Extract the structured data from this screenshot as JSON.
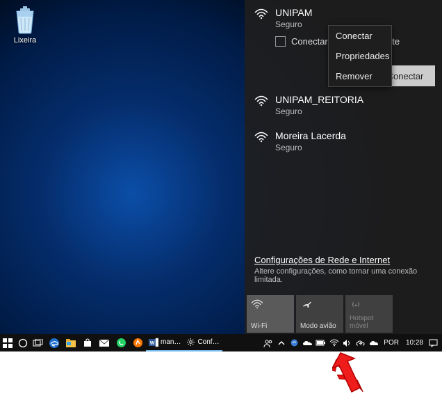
{
  "desktop": {
    "recycle_bin_label": "Lixeira"
  },
  "wifi_panel": {
    "networks": [
      {
        "name": "UNIPAM",
        "status": "Seguro",
        "auto_connect_label": "Conectar automaticamente",
        "connect_button": "Conectar"
      },
      {
        "name": "UNIPAM_REITORIA",
        "status": "Seguro"
      },
      {
        "name": "Moreira Lacerda",
        "status": "Seguro"
      }
    ],
    "context_menu": {
      "items": [
        "Conectar",
        "Propriedades",
        "Remover"
      ]
    },
    "settings_link": "Configurações de Rede e Internet",
    "settings_sub": "Altere configurações, como tornar uma conexão limitada.",
    "tiles": [
      {
        "label": "Wi-Fi"
      },
      {
        "label": "Modo avião"
      },
      {
        "label": "Hotspot móvel"
      }
    ]
  },
  "taskbar": {
    "apps": {
      "word_label": "man…",
      "settings_label": "Conf…"
    },
    "lang": "POR",
    "clock": "10:28"
  }
}
